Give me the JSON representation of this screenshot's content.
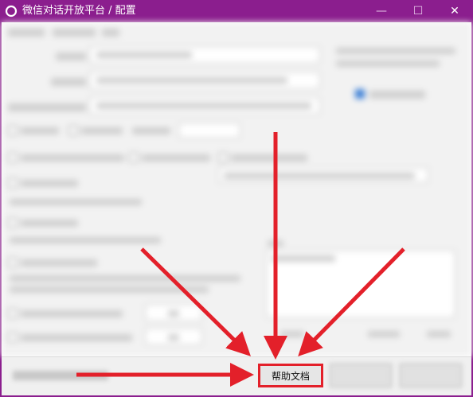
{
  "window": {
    "title": "微信对话开放平台 / 配置",
    "minimize_glyph": "—",
    "maximize_glyph": "☐",
    "close_glyph": "✕"
  },
  "buttons": {
    "help_label": "帮助文档"
  },
  "colors": {
    "titlebar": "#8b1e8e",
    "annotation_red": "#e3202a"
  },
  "icons": {
    "app": "app-logo-icon",
    "minimize": "minimize-icon",
    "maximize": "maximize-icon",
    "close": "close-icon"
  }
}
